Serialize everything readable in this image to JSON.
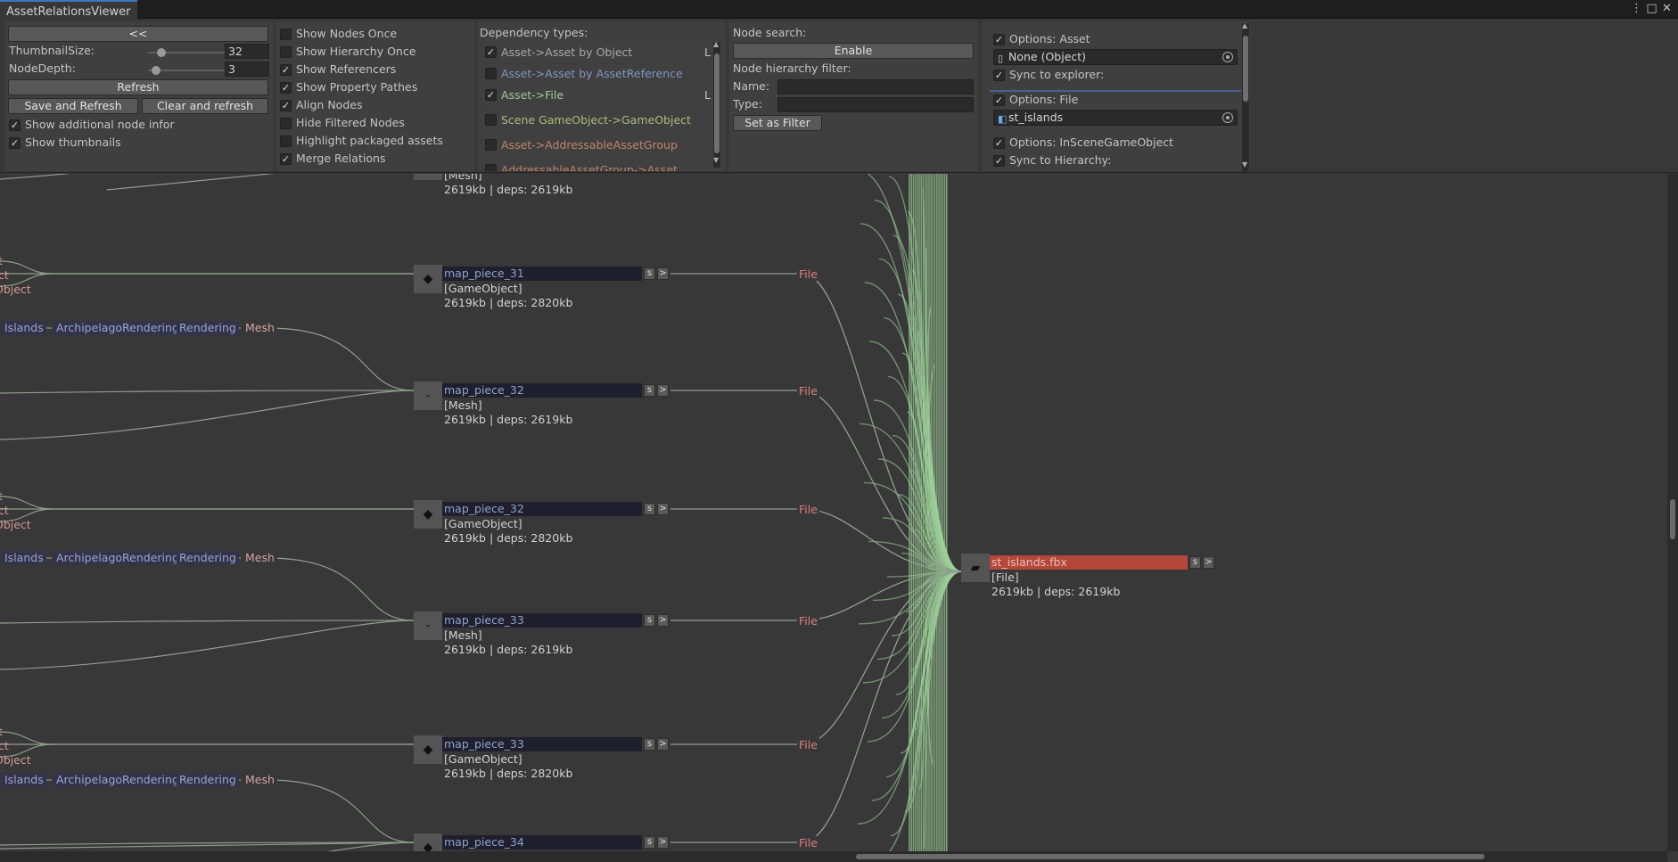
{
  "window": {
    "tab_title": "AssetRelationsViewer",
    "menu_icon": "kebab-menu-icon",
    "maximize_icon": "maximize-icon",
    "close_icon": "close-icon"
  },
  "panel_general": {
    "collapse_label": "<<",
    "thumbnail_size_label": "ThumbnailSize:",
    "thumbnail_size_value": "32",
    "thumbnail_size_fraction": 0.18,
    "node_depth_label": "NodeDepth:",
    "node_depth_value": "3",
    "node_depth_fraction": 0.1,
    "refresh_label": "Refresh",
    "save_refresh_label": "Save and Refresh",
    "clear_refresh_label": "Clear and refresh",
    "show_additional_label": "Show additional node informa",
    "show_additional_checked": true,
    "show_thumbnails_label": "Show thumbnails",
    "show_thumbnails_checked": true
  },
  "panel_display": {
    "options": [
      {
        "label": "Show Nodes Once",
        "checked": false
      },
      {
        "label": "Show Hierarchy Once",
        "checked": false
      },
      {
        "label": "Show Referencers",
        "checked": true
      },
      {
        "label": "Show Property Pathes",
        "checked": true
      },
      {
        "label": "Align Nodes",
        "checked": true
      },
      {
        "label": "Hide Filtered Nodes",
        "checked": false
      },
      {
        "label": "Highlight packaged assets",
        "checked": false
      },
      {
        "label": "Merge Relations",
        "checked": true
      }
    ]
  },
  "panel_dependency": {
    "title": "Dependency types:",
    "types": [
      {
        "label": "Asset->Asset by Object",
        "checked": true,
        "suffix": "L",
        "color": "#a8a8a8"
      },
      {
        "label": "Asset->Asset by AssetReference",
        "checked": false,
        "suffix": "",
        "color": "#7f95c4"
      },
      {
        "label": "Asset->File",
        "checked": true,
        "suffix": "L",
        "color": "#a3c79c"
      },
      {
        "label": "Scene GameObject->GameObject",
        "checked": false,
        "suffix": "",
        "color": "#a6bc7c"
      },
      {
        "label": "Asset->AddressableAssetGroup",
        "checked": false,
        "suffix": "",
        "color": "#c0846a"
      },
      {
        "label": "AddressableAssetGroup->Asset",
        "checked": false,
        "suffix": "",
        "color": "#c0846a"
      }
    ],
    "scroll_up_icon": "scroll-up-arrow-icon",
    "scroll_down_icon": "scroll-down-arrow-icon"
  },
  "panel_search": {
    "node_search_label": "Node search:",
    "enable_label": "Enable",
    "hierarchy_filter_label": "Node hierarchy filter:",
    "name_label": "Name:",
    "name_value": "",
    "type_label": "Type:",
    "type_value": "",
    "set_filter_label": "Set as Filter"
  },
  "panel_options": {
    "asset_options_label": "Options: Asset",
    "asset_options_checked": true,
    "asset_object_value": "None (Object)",
    "sync_explorer_label": "Sync to explorer:",
    "sync_explorer_checked": true,
    "file_options_label": "Options: File",
    "file_options_checked": true,
    "file_object_value": "st_islands",
    "inscene_options_label": "Options: InSceneGameObject",
    "inscene_options_checked": true,
    "sync_hierarchy_label": "Sync to Hierarchy:",
    "sync_hierarchy_checked": true
  },
  "graph": {
    "nodes": [
      {
        "name": "",
        "type": "[Mesh]",
        "size": "2619kb | deps: 2619kb",
        "partial": true
      },
      {
        "name": "map_piece_31",
        "type": "[GameObject]",
        "size": "2619kb | deps: 2820kb"
      },
      {
        "name": "map_piece_32",
        "type": "[Mesh]",
        "size": "2619kb | deps: 2619kb"
      },
      {
        "name": "map_piece_32",
        "type": "[GameObject]",
        "size": "2619kb | deps: 2820kb"
      },
      {
        "name": "map_piece_33",
        "type": "[Mesh]",
        "size": "2619kb | deps: 2619kb"
      },
      {
        "name": "map_piece_33",
        "type": "[GameObject]",
        "size": "2619kb | deps: 2820kb"
      },
      {
        "name": "map_piece_34",
        "type": "",
        "size": ""
      }
    ],
    "node_button_s": "s",
    "node_button_go": ">",
    "edge_label": "File",
    "target": {
      "name": "st_islands.fbx",
      "type": "[File]",
      "size": "2619kb | deps: 2619kb"
    },
    "path_chips": [
      "Islands",
      "ArchipelagoRendering",
      "Rendering",
      "Mesh"
    ],
    "left_fragments": [
      "t",
      "ct",
      "Object"
    ],
    "colors": {
      "edge": "#8f9f8c",
      "bundle": "#9fd29a",
      "target_bar": "#b4463a"
    }
  }
}
